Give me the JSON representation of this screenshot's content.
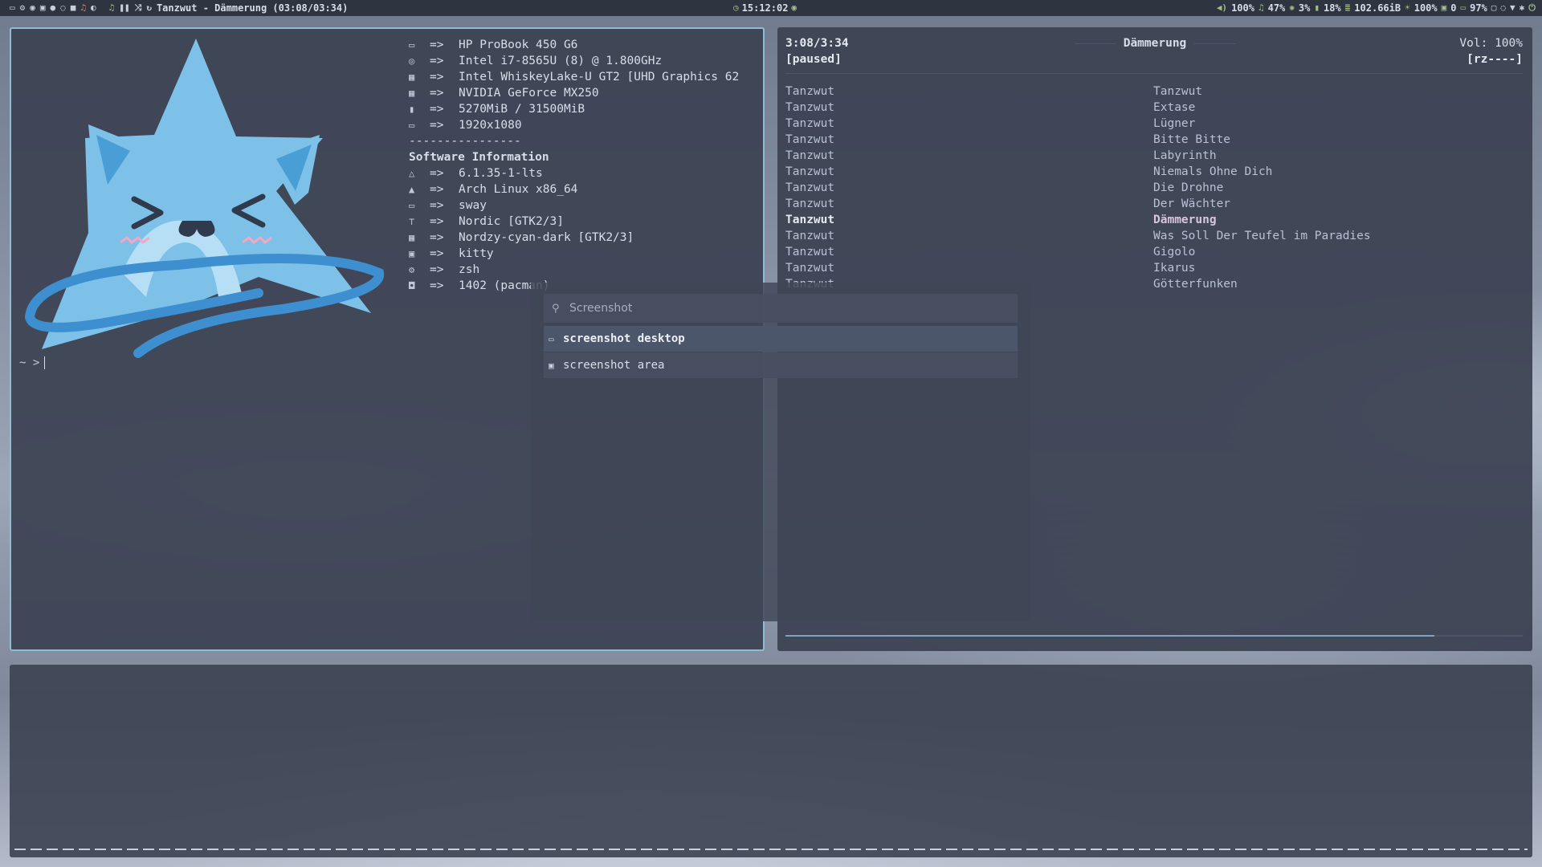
{
  "colors": {
    "accent": "#8fbcd4",
    "bar_bg": "#2e3440",
    "pane_bg": "#3b4252",
    "nord_green": "#a3be8c"
  },
  "topbar": {
    "left_icons": [
      "monitor-icon",
      "gear-icon",
      "firefox-icon",
      "terminal-icon",
      "chat-icon",
      "whatsapp-icon",
      "folder-icon",
      "music-icon",
      "steam-icon"
    ],
    "player_controls": [
      "music-note-icon",
      "pause-icon",
      "shuffle-icon",
      "repeat-icon"
    ],
    "now_playing": "Tanzwut - Dämmerung (03:08/03:34)",
    "clock": "15:12:02",
    "volume": "100%",
    "music_volume": "47%",
    "cpu": "3%",
    "memory": "18%",
    "disk": "102.66iB",
    "brightness": "100%",
    "updates": "0",
    "battery": "97%"
  },
  "fastfetch": {
    "arrow": "=>",
    "hardware": [
      {
        "icon": "laptop-icon",
        "value": "HP ProBook 450 G6"
      },
      {
        "icon": "cpu-icon",
        "value": "Intel i7-8565U (8) @ 1.800GHz"
      },
      {
        "icon": "gpu-icon",
        "value": "Intel WhiskeyLake-U GT2 [UHD Graphics 62"
      },
      {
        "icon": "gpu-icon",
        "value": "NVIDIA GeForce MX250"
      },
      {
        "icon": "memory-icon",
        "value": "5270MiB / 31500MiB"
      },
      {
        "icon": "display-icon",
        "value": "1920x1080"
      }
    ],
    "separator": "----------------",
    "software_heading": "Software Information",
    "software": [
      {
        "icon": "linux-icon",
        "value": "6.1.35-1-lts"
      },
      {
        "icon": "arch-icon",
        "value": "Arch Linux x86_64"
      },
      {
        "icon": "window-icon",
        "value": "sway"
      },
      {
        "icon": "paint-icon",
        "value": "Nordic [GTK2/3]"
      },
      {
        "icon": "grid-icon",
        "value": "Nordzy-cyan-dark [GTK2/3]"
      },
      {
        "icon": "terminal-icon",
        "value": "kitty"
      },
      {
        "icon": "gear-icon",
        "value": "zsh"
      },
      {
        "icon": "package-icon",
        "value": "1402 (pacman)"
      }
    ],
    "prompt": "~ >"
  },
  "player": {
    "time": "3:08/3:34",
    "state": "[paused]",
    "title": "Dämmerung",
    "volume": "Vol: 100%",
    "flags": "[rz----]",
    "progress": 0.88,
    "playlist": [
      {
        "artist": "Tanzwut",
        "track": "Tanzwut",
        "current": false
      },
      {
        "artist": "Tanzwut",
        "track": "Extase",
        "current": false
      },
      {
        "artist": "Tanzwut",
        "track": "Lügner",
        "current": false
      },
      {
        "artist": "Tanzwut",
        "track": "Bitte Bitte",
        "current": false
      },
      {
        "artist": "Tanzwut",
        "track": "Labyrinth",
        "current": false
      },
      {
        "artist": "Tanzwut",
        "track": "Niemals Ohne Dich",
        "current": false
      },
      {
        "artist": "Tanzwut",
        "track": "Die Drohne",
        "current": false
      },
      {
        "artist": "Tanzwut",
        "track": "Der Wächter",
        "current": false
      },
      {
        "artist": "Tanzwut",
        "track": "Dämmerung",
        "current": true
      },
      {
        "artist": "Tanzwut",
        "track": "Was Soll Der Teufel im Paradies",
        "current": false
      },
      {
        "artist": "Tanzwut",
        "track": "Gigolo",
        "current": false
      },
      {
        "artist": "Tanzwut",
        "track": "Ikarus",
        "current": false
      },
      {
        "artist": "Tanzwut",
        "track": "Götterfunken",
        "current": false
      }
    ]
  },
  "launcher": {
    "query": "Screenshot",
    "items": [
      {
        "icon": "monitor-icon",
        "label": "screenshot desktop"
      },
      {
        "icon": "image-icon",
        "label": "screenshot area"
      }
    ]
  }
}
